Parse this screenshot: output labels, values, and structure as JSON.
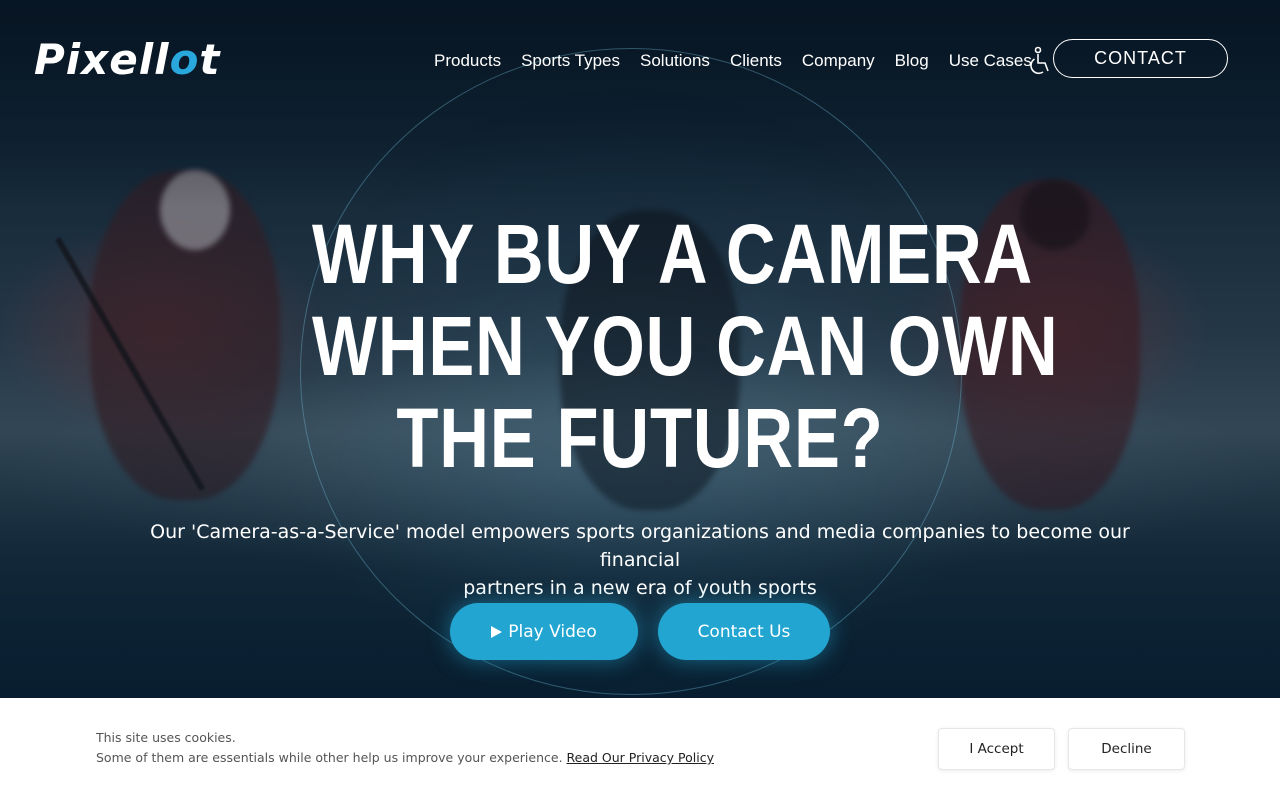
{
  "logo": {
    "text_main": "Pixell",
    "text_accent": "o",
    "text_end": "t"
  },
  "nav": {
    "items": [
      {
        "label": "Products"
      },
      {
        "label": "Sports Types"
      },
      {
        "label": "Solutions"
      },
      {
        "label": "Clients"
      },
      {
        "label": "Company"
      },
      {
        "label": "Blog"
      },
      {
        "label": "Use Cases"
      }
    ],
    "accessibility_icon": "wheelchair-icon",
    "contact_label": "CONTACT"
  },
  "hero": {
    "headline_lines": [
      "WHY BUY A CAMERA",
      "WHEN YOU CAN OWN",
      "THE FUTURE?"
    ],
    "subtitle_line1": "Our 'Camera-as-a-Service' model empowers sports organizations and media companies to become our financial",
    "subtitle_line2": "partners in a new era of youth sports",
    "play_video_label": "Play Video",
    "play_icon": "play-icon",
    "contact_us_label": "Contact Us"
  },
  "cookie_banner": {
    "line1": "This site uses cookies.",
    "line2": "Some of them are essentials while other help us improve your experience.",
    "privacy_link": "Read Our Privacy Policy",
    "accept_label": "I Accept",
    "decline_label": "Decline"
  },
  "colors": {
    "accent": "#22a6d1",
    "logo_accent": "#29a8dd"
  }
}
